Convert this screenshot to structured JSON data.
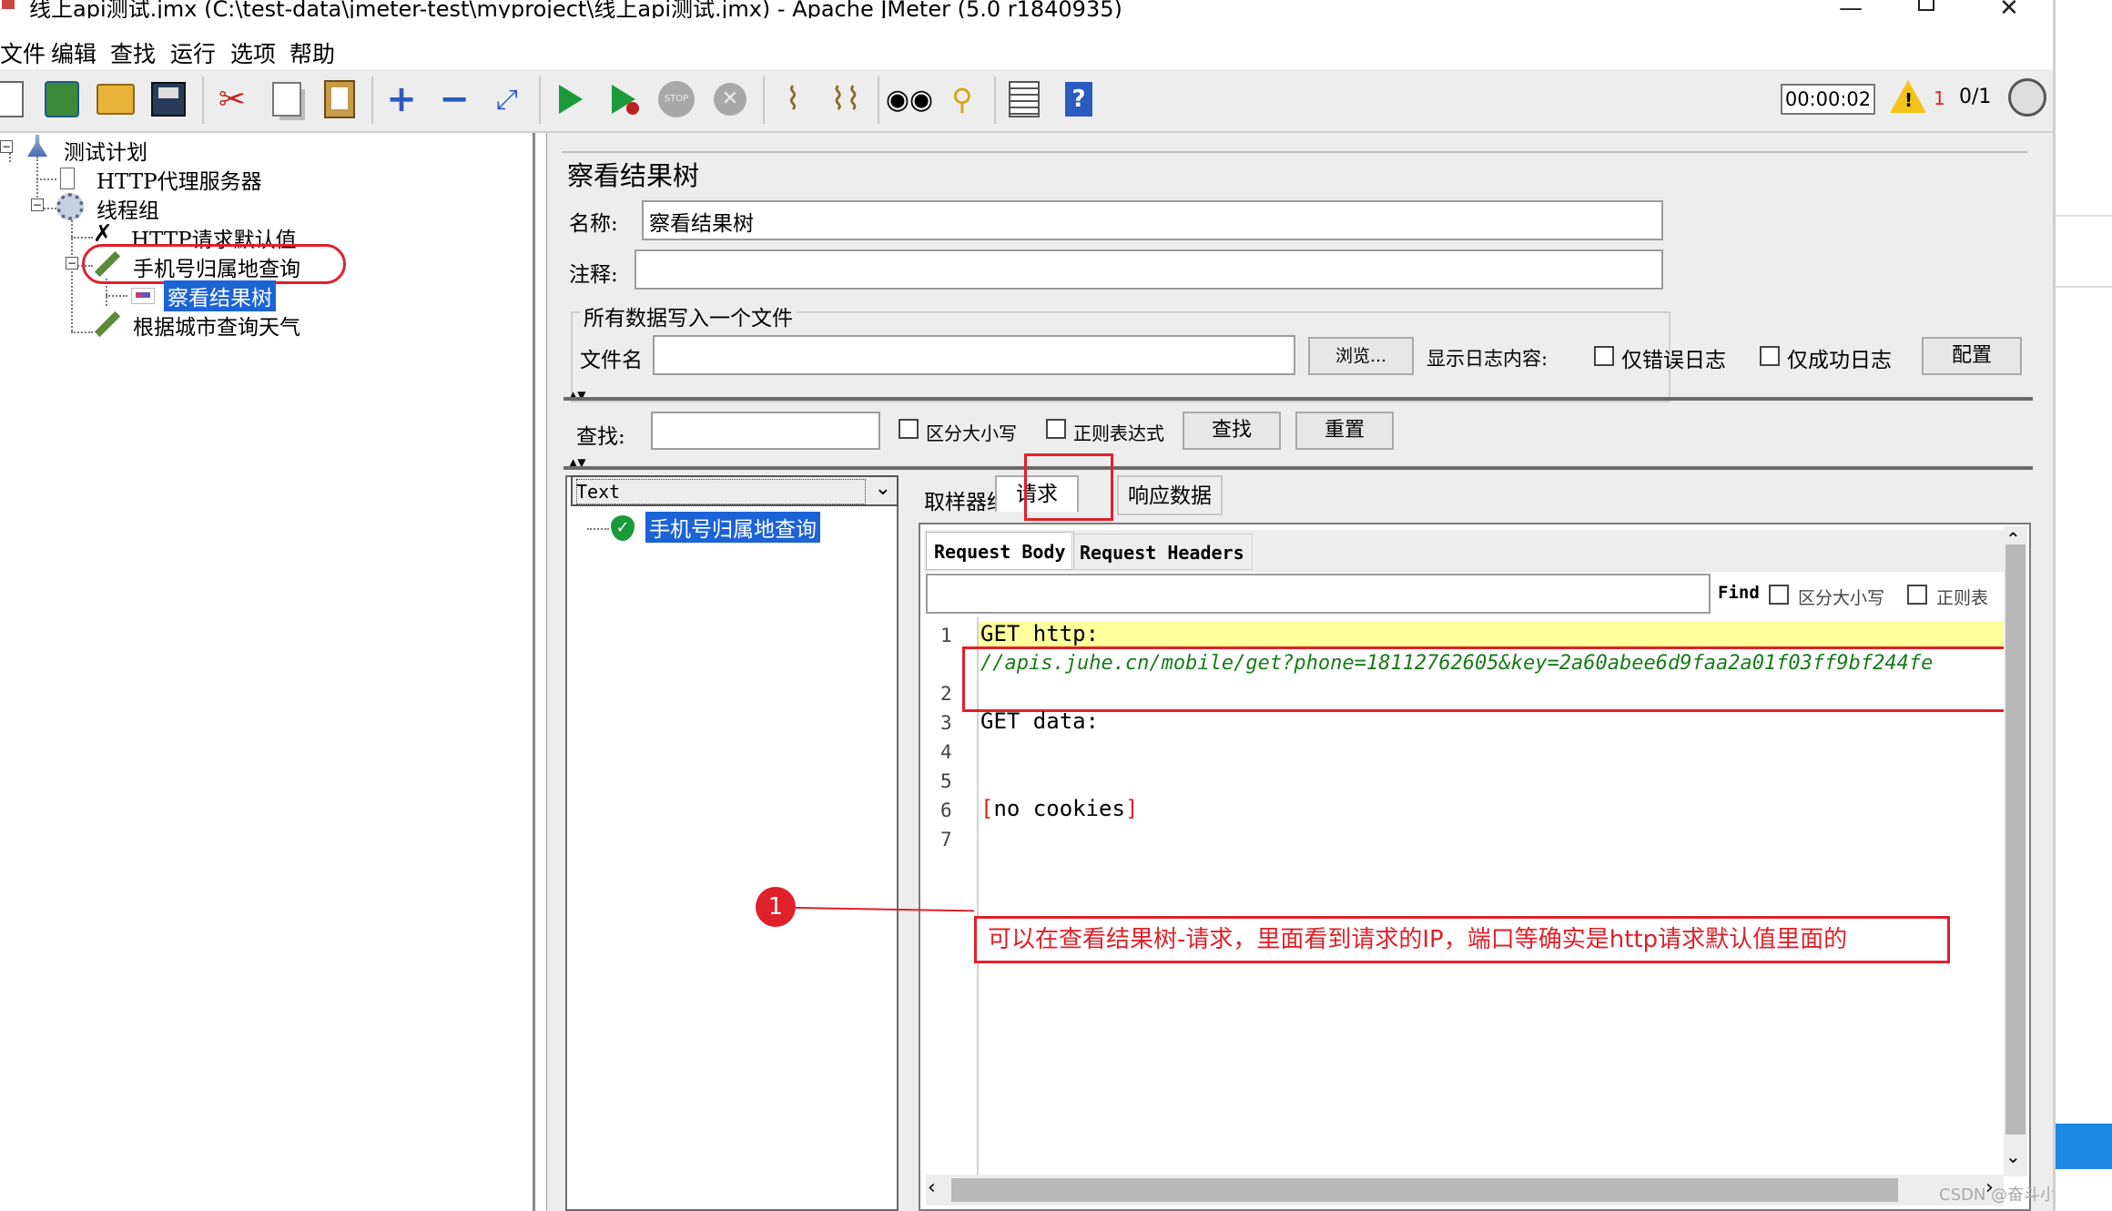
{
  "window": {
    "title": "线上api测试.jmx (C:\\test-data\\jmeter-test\\myproject\\线上api测试.jmx) - Apache JMeter (5.0 r1840935)"
  },
  "menu": [
    "文件",
    "编辑",
    "查找",
    "运行",
    "选项",
    "帮助"
  ],
  "toolbar": {
    "icons": [
      "new-icon",
      "templates-icon",
      "open-icon",
      "save-icon",
      "cut-icon",
      "copy-icon",
      "paste-icon",
      "expand-icon",
      "collapse-icon",
      "toggle-icon",
      "start-icon",
      "start-no-timers-icon",
      "stop-icon",
      "shutdown-icon",
      "clear-icon",
      "clear-all-icon",
      "search-icon",
      "reset-search-icon",
      "function-helper-icon",
      "help-icon"
    ],
    "timer": "00:00:02",
    "warn_count": "1",
    "threads": "0/1"
  },
  "tree": {
    "items": [
      {
        "label": "测试计划"
      },
      {
        "label": "HTTP代理服务器"
      },
      {
        "label": "线程组"
      },
      {
        "label": "HTTP请求默认值"
      },
      {
        "label": "手机号归属地查询"
      },
      {
        "label": "察看结果树"
      },
      {
        "label": "根据城市查询天气"
      }
    ]
  },
  "panel": {
    "title": "察看结果树",
    "name_label": "名称:",
    "name_value": "察看结果树",
    "comment_label": "注释:",
    "file_group": "所有数据写入一个文件",
    "filename_label": "文件名",
    "browse": "浏览...",
    "log_label": "显示日志内容:",
    "errors_only": "仅错误日志",
    "success_only": "仅成功日志",
    "configure": "配置",
    "search_label": "查找:",
    "case_sensitive": "区分大小写",
    "regex": "正则表达式",
    "find_btn": "查找",
    "reset_btn": "重置"
  },
  "results": {
    "renderer": "Text",
    "sample": "手机号归属地查询",
    "tabs": [
      "取样器结果",
      "请求",
      "响应数据"
    ],
    "subtabs": [
      "Request Body",
      "Request Headers"
    ],
    "find_label": "Find",
    "find_case": "区分大小写",
    "find_regex": "正则表",
    "lines": [
      "1",
      "2",
      "3",
      "4",
      "5",
      "6",
      "7"
    ],
    "code": {
      "l1": "GET http:",
      "l1b": "//apis.juhe.cn/mobile/get?phone=18112762605&key=2a60abee6d9faa2a01f03ff9bf244fe",
      "l3": "GET data:",
      "l6_open": "[",
      "l6_text": "no cookies",
      "l6_close": "]"
    }
  },
  "annotation": {
    "number": "1",
    "text": "可以在查看结果树-请求，里面看到请求的IP，端口等确实是http请求默认值里面的"
  },
  "watermark": "CSDN @奋斗小女巫",
  "colors": {
    "accent": "#1c63d6",
    "annotation": "#e0202a",
    "highlight": "#ffff9c",
    "url": "#1a7a1a"
  }
}
